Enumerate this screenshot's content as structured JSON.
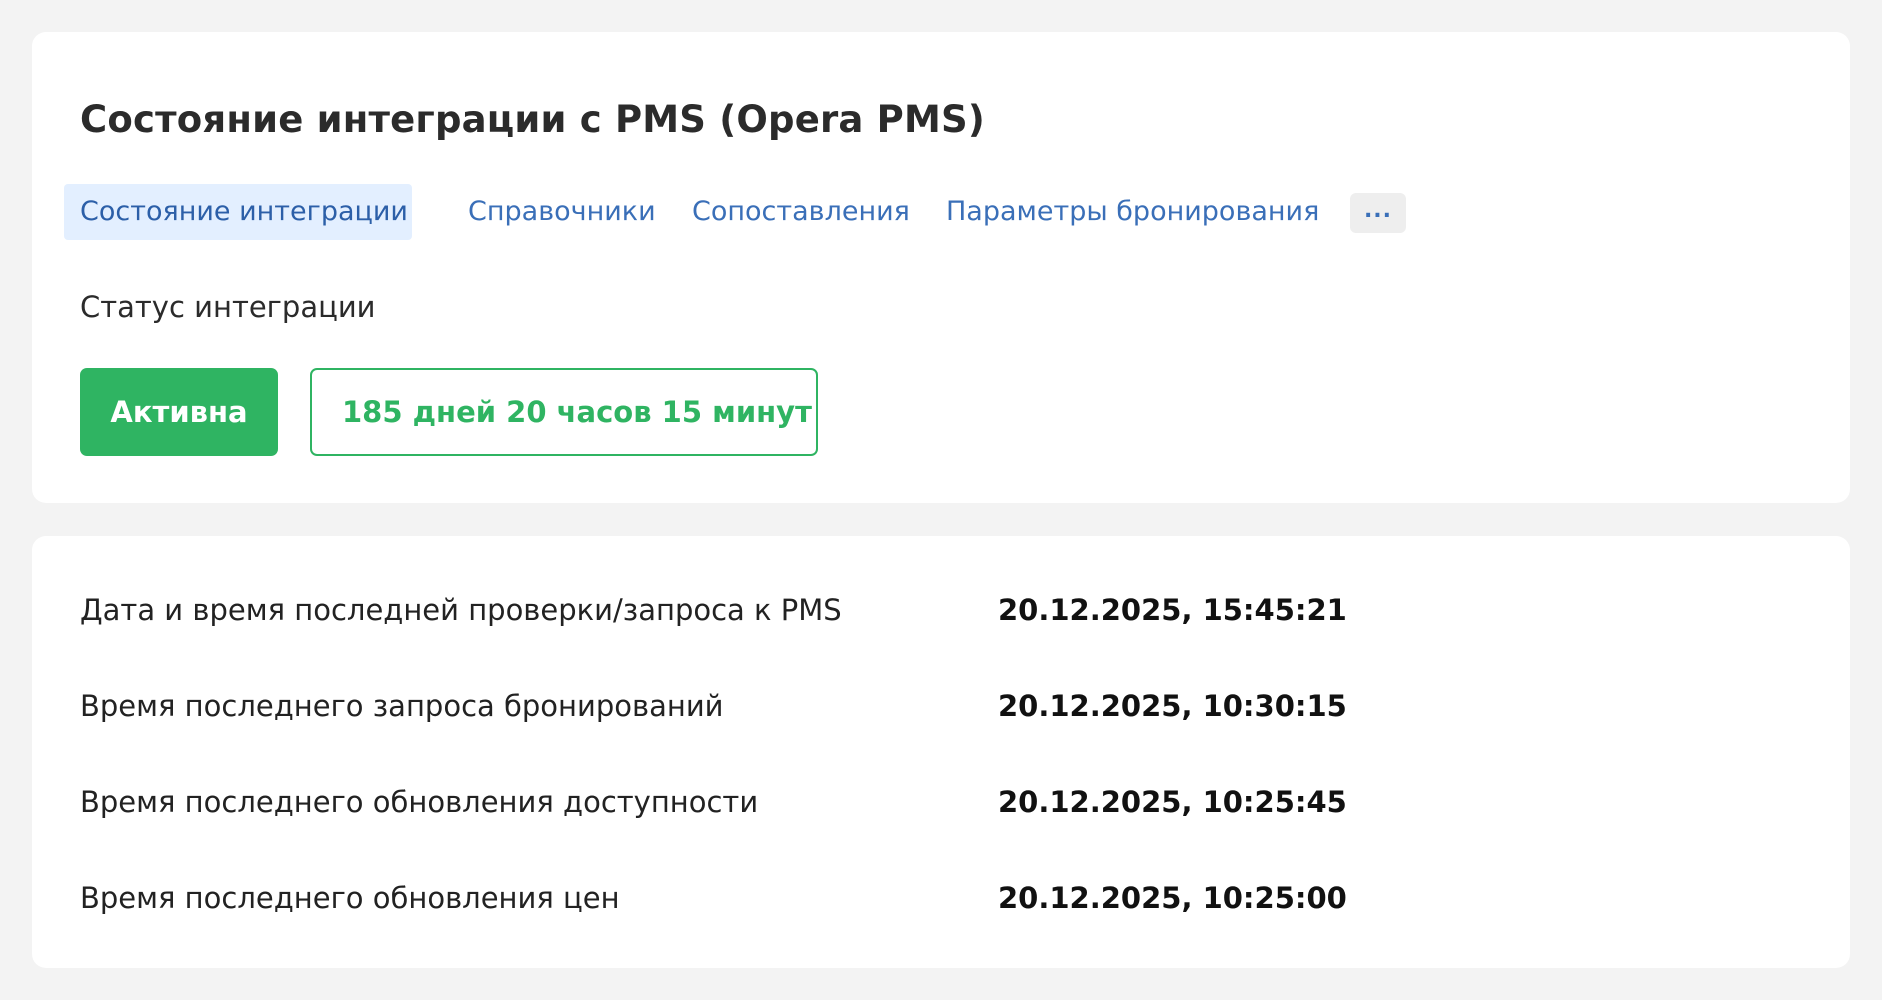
{
  "header": {
    "title": "Состояние интеграции с PMS (Opera PMS)"
  },
  "tabs": [
    {
      "label": "Состояние интеграции",
      "active": true
    },
    {
      "label": "Справочники",
      "active": false
    },
    {
      "label": "Сопоставления",
      "active": false
    },
    {
      "label": "Параметры бронирования",
      "active": false
    }
  ],
  "more_button": {
    "label": "...",
    "icon": "more-horizontal-icon"
  },
  "status": {
    "label": "Статус интеграции",
    "badge": "Активна",
    "uptime": "185 дней 20 часов 15 минут"
  },
  "info_rows": [
    {
      "label": "Дата и время последней проверки/запроса к PMS",
      "value": "20.12.2025, 15:45:21"
    },
    {
      "label": "Время последнего запроса бронирований",
      "value": "20.12.2025, 10:30:15"
    },
    {
      "label": "Время последнего обновления доступности",
      "value": "20.12.2025, 10:25:45"
    },
    {
      "label": "Время последнего обновления цен",
      "value": "20.12.2025, 10:25:00"
    }
  ],
  "colors": {
    "background": "#f3f3f3",
    "card": "#ffffff",
    "accent_link": "#3a6fb8",
    "active_tab_bg": "#e3efff",
    "success": "#2fb462"
  }
}
